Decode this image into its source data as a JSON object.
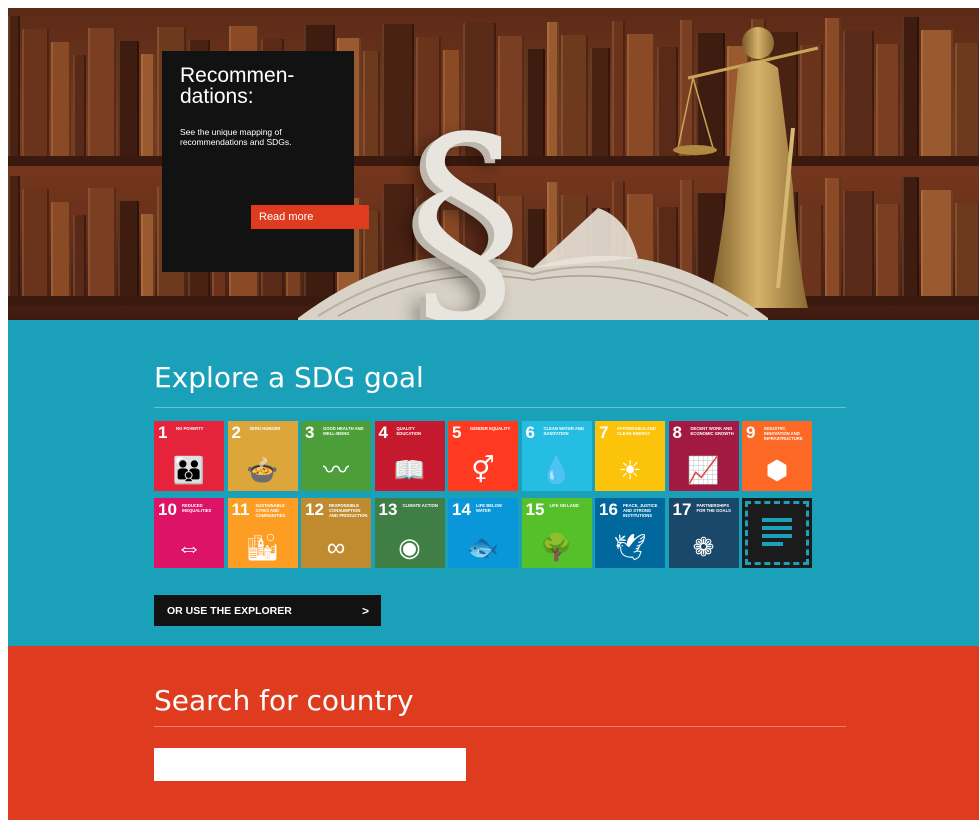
{
  "hero": {
    "title": "Recommen- dations:",
    "description": "See the unique mapping of recommendations and SDGs.",
    "button_label": "Read more"
  },
  "explore": {
    "title": "Explore a SDG goal",
    "goals": [
      {
        "number": "1",
        "label": "No poverty",
        "color": "#e5243b",
        "icon": "family-icon"
      },
      {
        "number": "2",
        "label": "Zero hunger",
        "color": "#dda63a",
        "icon": "bowl-icon"
      },
      {
        "number": "3",
        "label": "Good health and well-being",
        "color": "#4c9f38",
        "icon": "heartbeat-icon"
      },
      {
        "number": "4",
        "label": "Quality education",
        "color": "#c5192d",
        "icon": "book-icon"
      },
      {
        "number": "5",
        "label": "Gender equality",
        "color": "#ff3a21",
        "icon": "gender-icon"
      },
      {
        "number": "6",
        "label": "Clean water and sanitation",
        "color": "#26bde2",
        "icon": "water-icon"
      },
      {
        "number": "7",
        "label": "Affordable and clean energy",
        "color": "#fcc30b",
        "icon": "sun-icon"
      },
      {
        "number": "8",
        "label": "Decent work and economic growth",
        "color": "#a21942",
        "icon": "growth-chart-icon"
      },
      {
        "number": "9",
        "label": "Industry, innovation and infrastructure",
        "color": "#fd6925",
        "icon": "cubes-icon"
      },
      {
        "number": "10",
        "label": "Reduced inequalities",
        "color": "#dd1367",
        "icon": "equality-arrows-icon"
      },
      {
        "number": "11",
        "label": "Sustainable cities and communities",
        "color": "#fd9d24",
        "icon": "city-icon"
      },
      {
        "number": "12",
        "label": "Responsible consumption and production",
        "color": "#bf8b2e",
        "icon": "infinity-icon"
      },
      {
        "number": "13",
        "label": "Climate action",
        "color": "#3f7e44",
        "icon": "eye-globe-icon"
      },
      {
        "number": "14",
        "label": "Life below water",
        "color": "#0a97d9",
        "icon": "fish-icon"
      },
      {
        "number": "15",
        "label": "Life on land",
        "color": "#56c02b",
        "icon": "tree-icon"
      },
      {
        "number": "16",
        "label": "Peace, justice and strong institutions",
        "color": "#00689d",
        "icon": "dove-icon"
      },
      {
        "number": "17",
        "label": "Partnerships for the goals",
        "color": "#19486a",
        "icon": "rings-icon"
      }
    ],
    "explorer_label": "OR USE THE EXPLORER",
    "explorer_arrow": ">"
  },
  "search": {
    "title": "Search for country",
    "input_value": "",
    "input_placeholder": ""
  }
}
